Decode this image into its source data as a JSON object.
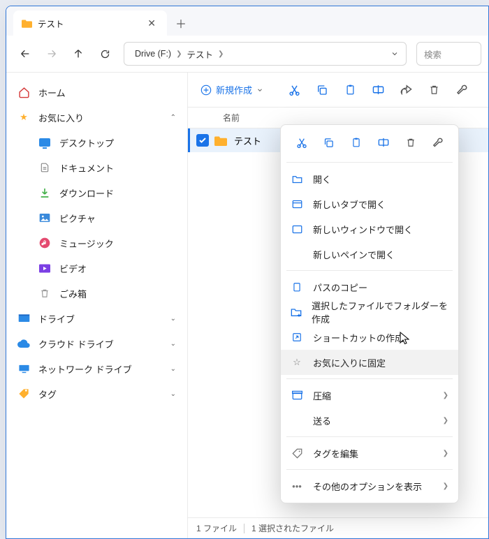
{
  "tab": {
    "title": "テスト"
  },
  "breadcrumb": [
    "Drive (F:)",
    "テスト"
  ],
  "search_placeholder": "検索",
  "toolbar": {
    "new_label": "新規作成"
  },
  "columns": {
    "name": "名前"
  },
  "rows": [
    {
      "name": "テスト"
    }
  ],
  "sidebar": {
    "home": "ホーム",
    "favorites": "お気に入り",
    "fav_items": [
      "デスクトップ",
      "ドキュメント",
      "ダウンロード",
      "ピクチャ",
      "ミュージック",
      "ビデオ",
      "ごみ箱"
    ],
    "groups": [
      "ドライブ",
      "クラウド ドライブ",
      "ネットワーク ドライブ",
      "タグ"
    ]
  },
  "context_menu": {
    "items": [
      "開く",
      "新しいタブで開く",
      "新しいウィンドウで開く",
      "新しいペインで開く",
      "パスのコピー",
      "選択したファイルでフォルダーを作成",
      "ショートカットの作成",
      "お気に入りに固定",
      "圧縮",
      "送る",
      "タグを編集",
      "その他のオプションを表示"
    ]
  },
  "status": {
    "count": "1 ファイル",
    "selected": "1 選択されたファイル"
  }
}
